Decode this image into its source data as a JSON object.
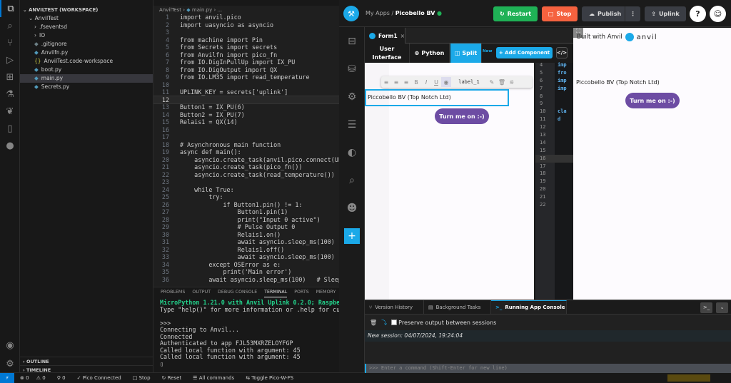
{
  "vscode": {
    "explorer": {
      "workspace": "ANVILTEST (WORKSPACE)",
      "folder": "AnvilTest",
      "items": [
        ".fseventsd",
        "IO",
        ".gitignore",
        "Anvilfn.py",
        "AnvilTest.code-workspace",
        "boot.py",
        "main.py",
        "Secrets.py"
      ],
      "outline": "OUTLINE",
      "timeline": "TIMELINE"
    },
    "breadcrumb": {
      "folder": "AnvilTest",
      "file": "main.py",
      "rest": "..."
    },
    "code": [
      "import anvil.pico",
      "import uasyncio as asyncio",
      "",
      "from machine import Pin",
      "from Secrets import secrets",
      "from Anvilfn import pico_fn",
      "from IO.DigInPullUp import IX_PU",
      "from IO.DigOutput import QX",
      "from IO.LM35 import read_temperature",
      "",
      "UPLINK_KEY = secrets['uplink']",
      "",
      "Button1 = IX_PU(6)",
      "Button2 = IX_PU(7)",
      "Relais1 = QX(14)",
      "",
      "",
      "# Asynchronous main function",
      "async def main():",
      "    asyncio.create_task(anvil.pico.connect(UPLI",
      "    asyncio.create_task(pico_fn())",
      "    asyncio.create_task(read_temperature())",
      "",
      "    while True:",
      "        try:",
      "            if Button1.pin() != 1:",
      "                Button1.pin(1)",
      "                print(\"Input 0 active\")",
      "                # Pulse Output 0",
      "                Relais1.on()",
      "                await asyncio.sleep_ms(100)   #",
      "                Relais1.off()",
      "                await asyncio.sleep_ms(100)   #",
      "        except OSError as e:",
      "            print('Main error')",
      "        await asyncio.sleep_ms(100)   # Sleep f"
    ],
    "panel_tabs": [
      "PROBLEMS",
      "OUTPUT",
      "DEBUG CONSOLE",
      "TERMINAL",
      "PORTS",
      "MEMORY"
    ],
    "terminal": {
      "banner": "MicroPython 1.21.0 with Anvil Uplink 0.2.0; Raspberry",
      "lines": [
        "Type \"help()\" for more information or .help for custo",
        "",
        ">>>",
        "Connecting to Anvil...",
        "Connected",
        "Authenticated to app FJL53MXRZELOYFGP",
        "Called local function with argument: 45",
        "Called local function with argument: 45"
      ]
    },
    "status": {
      "errors": "0",
      "warnings": "0",
      "ports": "0",
      "pico": "Pico Connected",
      "stop": "Stop",
      "reset": "Reset",
      "all_commands": "All commands",
      "toggle": "Toggle Pico-W-FS"
    }
  },
  "anvil": {
    "breadcrumb_root": "My Apps",
    "app_name": "Picobello BV",
    "buttons": {
      "restart": "Restart",
      "stop": "Stop",
      "publish": "Publish",
      "uplink": "Uplink",
      "help": "?"
    },
    "form_tab": "Form1",
    "tabs": {
      "ui_1": "User",
      "ui_2": "Interface",
      "python": "Python",
      "split": "Split",
      "new": "New",
      "add": "+ Add Component"
    },
    "toolbar": {
      "component": "label_1"
    },
    "label_text": "Piccobello BV (Top Notch Ltd)",
    "button_text": "Turn me on :-)",
    "code_lines": [
      "4",
      "5",
      "6",
      "7",
      "8",
      "9",
      "10",
      "11",
      "12",
      "13",
      "14",
      "15",
      "16",
      "17",
      "18",
      "19",
      "20",
      "21",
      "22"
    ],
    "code_snips": [
      "imp",
      "fro",
      "imp",
      "imp",
      "",
      "",
      "cla",
      "d"
    ],
    "preview": {
      "built_with": "Built with Anvil",
      "logo": "anvil"
    },
    "console_tabs": [
      "Version History",
      "Background Tasks",
      "Running App Console"
    ],
    "preserve": "Preserve output between sessions",
    "session": "New session: 04/07/2024, 19:24:04",
    "command_placeholder": ">>>  Enter a command (Shift-Enter for new line)",
    "colors": {
      "green": "#1fb156",
      "red": "#f5623f",
      "blue": "#1ba9e8",
      "purple": "#6d4ca3"
    }
  }
}
